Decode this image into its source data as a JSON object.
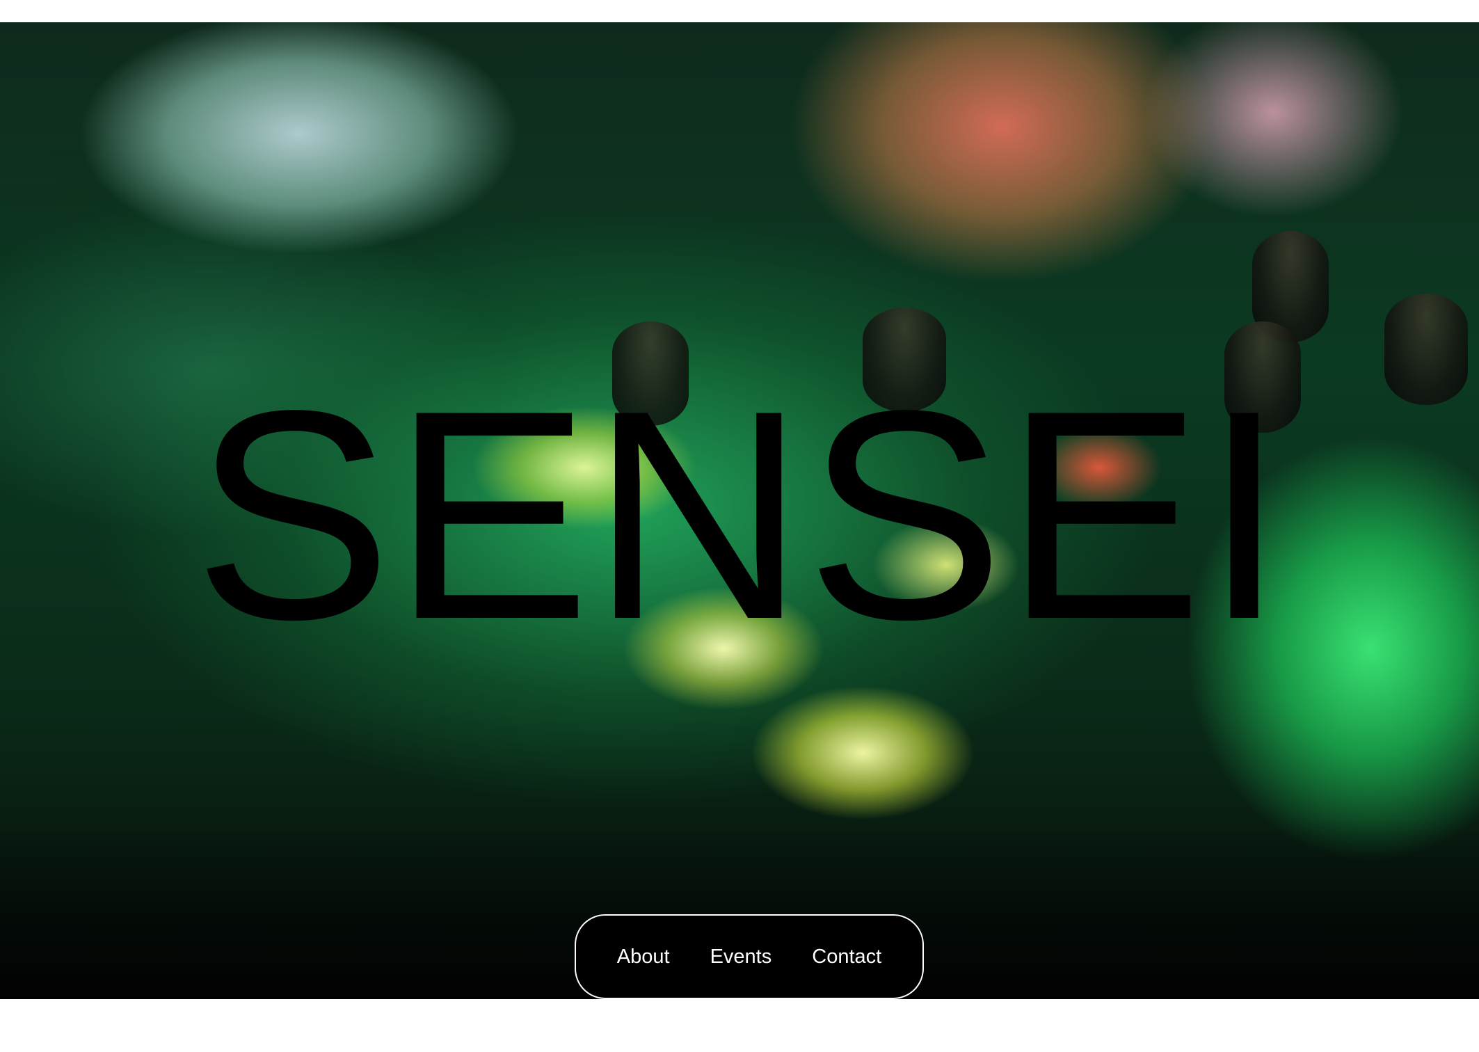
{
  "hero": {
    "title": "SENSEI"
  },
  "nav": {
    "items": [
      {
        "label": "About"
      },
      {
        "label": "Events"
      },
      {
        "label": "Contact"
      }
    ]
  },
  "colors": {
    "page_background": "#ffffff",
    "title_text": "#000000",
    "nav_background": "#000000",
    "nav_text": "#ffffff",
    "nav_border": "#ffffff"
  }
}
